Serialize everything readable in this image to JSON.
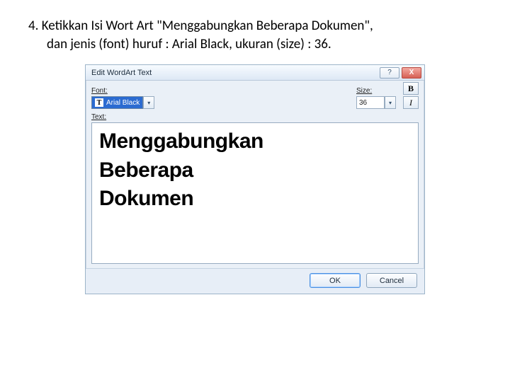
{
  "instruction": {
    "number": "4.",
    "line1": "Ketikkan Isi Wort Art \"Menggabungkan Beberapa Dokumen\",",
    "line2": "dan jenis (font) huruf : Arial Black, ukuran (size) : 36."
  },
  "dialog": {
    "title": "Edit WordArt Text",
    "help_icon": "?",
    "close_icon": "X",
    "font_label": "Font:",
    "font_value": "Arial Black",
    "font_glyph": "T",
    "size_label": "Size:",
    "size_value": "36",
    "bold_label": "B",
    "italic_label": "I",
    "text_label": "Text:",
    "editor_text": "Menggabungkan\nBeberapa\nDokumen",
    "ok_label": "OK",
    "cancel_label": "Cancel",
    "dropdown_glyph": "▾"
  }
}
